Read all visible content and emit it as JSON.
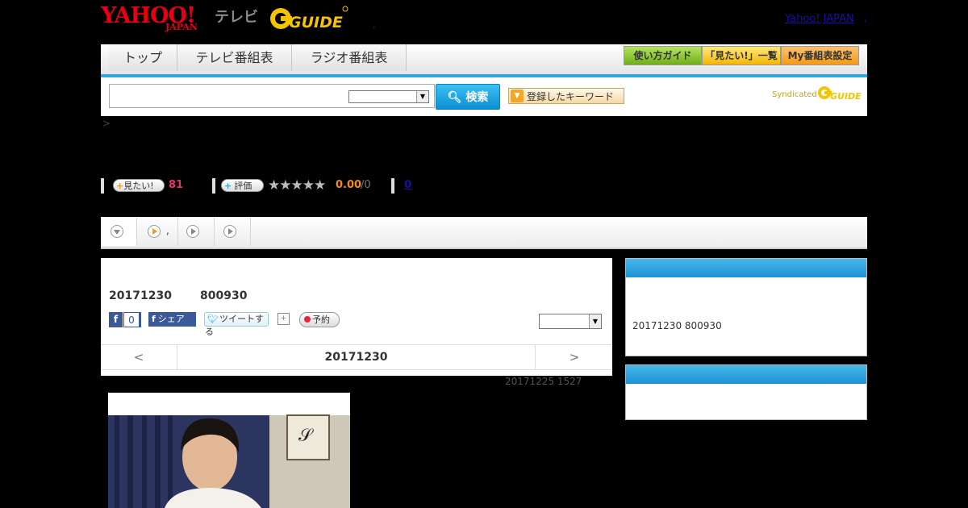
{
  "header": {
    "logo_yahoo": "YAHOO!",
    "logo_japan": "JAPAN",
    "logo_tv": "テレビ",
    "logo_gguide": "G-GUIDE",
    "yahoo_japan_link": "Yahoo! JAPAN",
    "link_sep": ","
  },
  "nav": {
    "tabs": [
      "トップ",
      "テレビ番組表",
      "ラジオ番組表"
    ],
    "btn_guide": "使い方ガイド",
    "btn_mitai": "「見たい!」一覧",
    "btn_my": "My番組表設定"
  },
  "search": {
    "input_value": "",
    "select_value": "",
    "button_label": "検索",
    "keyword_button": "登録したキーワード",
    "syndicated": "Syndicated",
    "syndicated_logo": "G-GUIDE"
  },
  "breadcrumb": ">",
  "stats": {
    "mitai_label": "見たい!",
    "mitai_count": "81",
    "rate_label": "評価",
    "stars": "★★★★★",
    "score": "0.00",
    "score_of": "/0",
    "review_count": "0"
  },
  "tabs_row": {
    "tab2_text": ","
  },
  "program": {
    "date": "20171230",
    "time": "800930",
    "fb_like_count": "0",
    "fb_share": "シェア",
    "tweet": "ツイートする",
    "reserve": "予約",
    "select_value": "",
    "nav_prev": "<",
    "nav_date": "20171230",
    "nav_next": ">",
    "updated": "20171225  1527"
  },
  "sidebar": {
    "box1_text": "20171230  800930"
  },
  "colors": {
    "accent_blue": "#2ea7df",
    "yahoo_red": "#e60012",
    "mitai_pink": "#e8336c",
    "score_orange": "#f18b1d"
  },
  "icons": [
    "search-icon",
    "dropdown-arrow-icon",
    "facebook-icon",
    "twitter-icon",
    "calendar-icon",
    "record-icon",
    "play-circle-icon"
  ]
}
